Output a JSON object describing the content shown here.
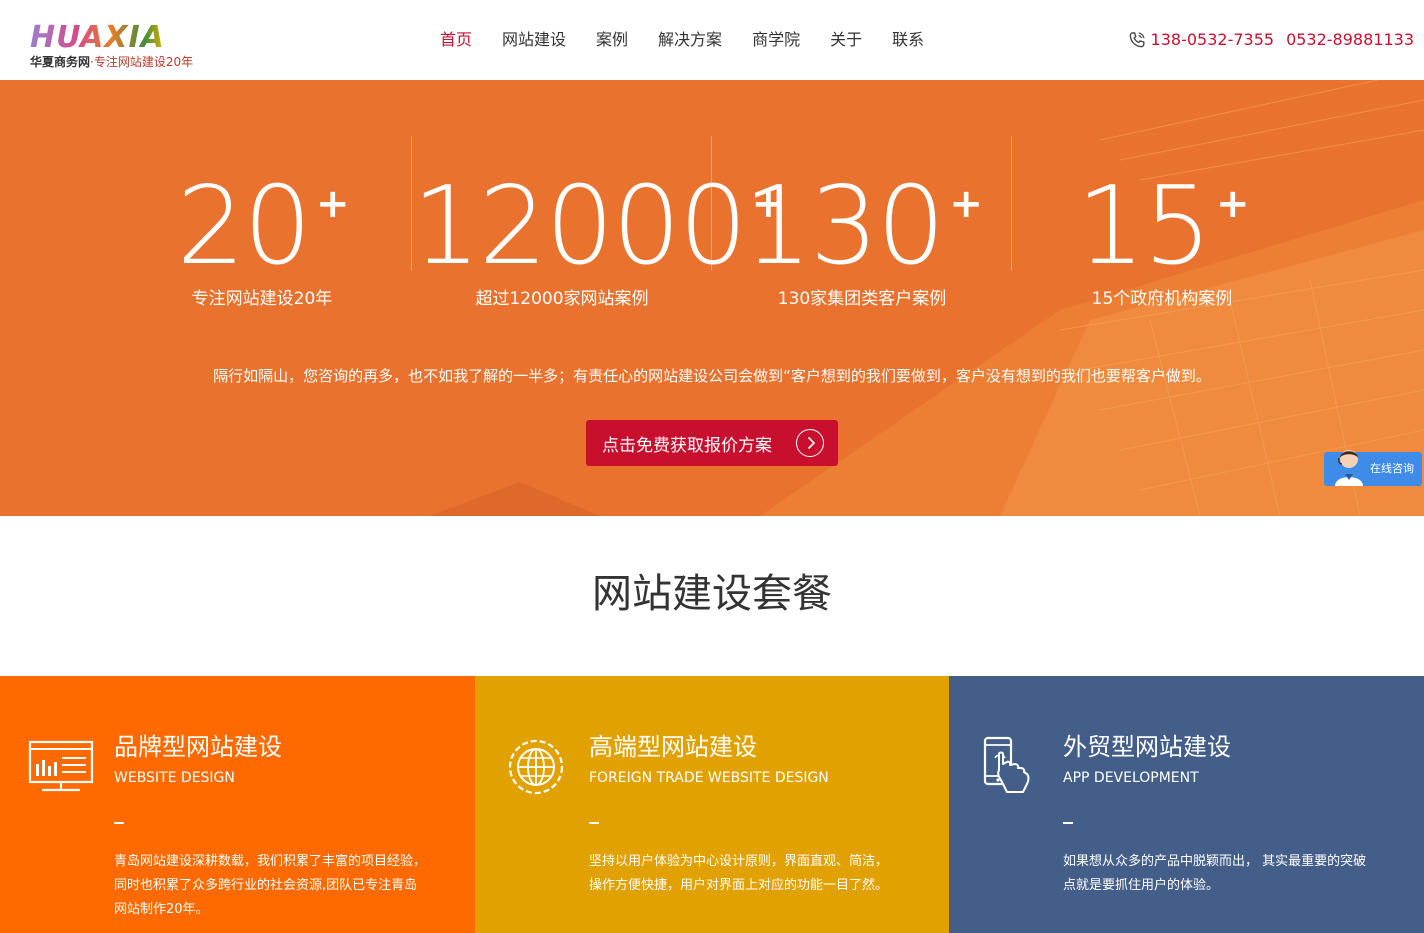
{
  "header": {
    "logo_text": "HUAXIA",
    "logo_brand": "华夏商务网",
    "logo_slogan": "·专注网站建设20年",
    "nav": [
      {
        "label": "首页",
        "active": true
      },
      {
        "label": "网站建设"
      },
      {
        "label": "案例"
      },
      {
        "label": "解决方案"
      },
      {
        "label": "商学院"
      },
      {
        "label": "关于"
      },
      {
        "label": "联系"
      }
    ],
    "phone_1": "138-0532-7355",
    "phone_2": "0532-89881133"
  },
  "hero": {
    "bg_color": "#e8722e",
    "stats": [
      {
        "value": "20",
        "suffix": "+",
        "label": "专注网站建设20年"
      },
      {
        "value": "12000",
        "suffix": "+",
        "label": "超过12000家网站案例"
      },
      {
        "value": "130",
        "suffix": "+",
        "label": "130家集团类客户案例"
      },
      {
        "value": "15",
        "suffix": "+",
        "label": "15个政府机构案例"
      }
    ],
    "quote": "隔行如隔山，您咨询的再多，也不如我了解的一半多；有责任心的网站建设公司会做到“客户想到的我们要做到，客户没有想到的我们也要帮客户做到。",
    "cta_label": "点击免费获取报价方案"
  },
  "chat_widget": {
    "label": "在线咨询"
  },
  "section_title": "网站建设套餐",
  "packages": [
    {
      "title": "品牌型网站建设",
      "subtitle": "WEBSITE DESIGN",
      "desc": "青岛网站建设深耕数载，我们积累了丰富的项目经验，同时也积累了众多跨行业的社会资源,团队已专注青岛网站制作20年。",
      "color": "#ff6a00",
      "icon": "monitor-chart-icon"
    },
    {
      "title": "高端型网站建设",
      "subtitle": "FOREIGN TRADE WEBSITE DESIGN",
      "desc": "坚持以用户体验为中心设计原则，界面直观、简洁，  操作方便快捷，用户对界面上对应的功能一目了然。",
      "color": "#e1a100",
      "icon": "globe-gear-icon"
    },
    {
      "title": "外贸型网站建设",
      "subtitle": "APP DEVELOPMENT",
      "desc": "如果想从众多的产品中脱颖而出，  其实最重要的突破点就是要抓住用户的体验。",
      "color": "#445e8a",
      "icon": "phone-touch-icon"
    }
  ]
}
